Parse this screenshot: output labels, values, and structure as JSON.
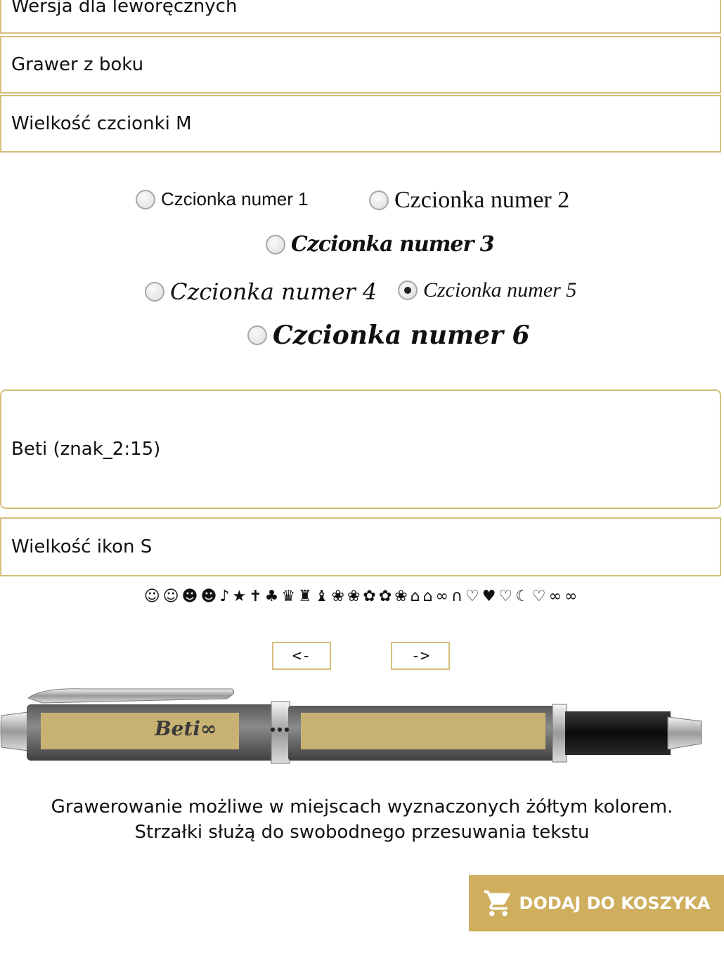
{
  "options": {
    "left_hand": "Wersja dla leworęcznych",
    "side_engraving": "Grawer z boku",
    "font_size": "Wielkość czcionki M"
  },
  "fonts": {
    "items": [
      {
        "label": "Czcionka numer 1",
        "selected": false
      },
      {
        "label": "Czcionka numer 2",
        "selected": false
      },
      {
        "label": "Czcionka numer 3",
        "selected": false
      },
      {
        "label": "Czcionka numer 4",
        "selected": false
      },
      {
        "label": "Czcionka numer 5",
        "selected": true
      },
      {
        "label": "Czcionka numer 6",
        "selected": false
      }
    ]
  },
  "engraving": {
    "text_value": "Beti (znak_2:15)",
    "preview": "Beti∞"
  },
  "icon_size": "Wielkość ikon S",
  "icons_row": "☺☺☻☻♪★✝♣♛♜♝❀❀✿✿❀⌂⌂∞∩♡♥♡☾♡∞∞",
  "arrows": {
    "left": "<-",
    "right": "->"
  },
  "info": {
    "line1": "Grawerowanie możliwe w miejscach wyznaczonych żółtym kolorem.",
    "line2": "Strzałki służą do swobodnego przesuwania tekstu"
  },
  "cart": {
    "label": "DODAJ DO KOSZYKA",
    "icon": "cart-icon"
  },
  "colors": {
    "accent": "#cfae5e",
    "border": "#d6bd7a",
    "engrave_zone": "#c8b273"
  }
}
